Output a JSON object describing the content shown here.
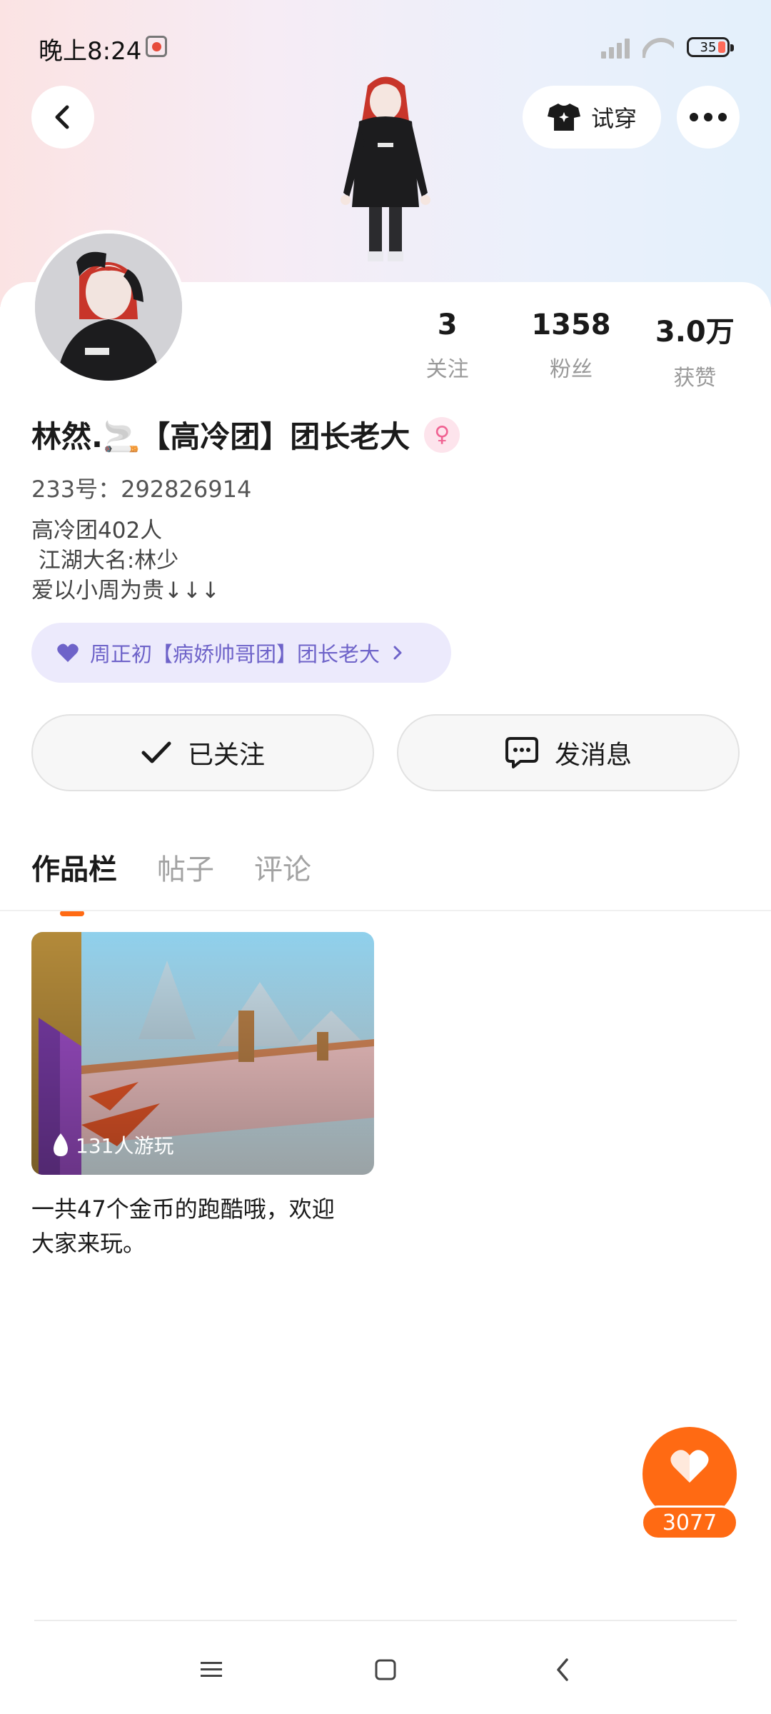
{
  "status_bar": {
    "time": "晚上8:24",
    "battery_level": "35",
    "icons": [
      "notification-icon",
      "signal-icon",
      "wifi-icon",
      "battery-icon"
    ]
  },
  "header": {
    "back_icon": "chevron-left-icon",
    "try_on_label": "试穿",
    "try_on_icon": "tshirt-icon",
    "more_icon": "more-dots-icon"
  },
  "profile": {
    "stats": [
      {
        "value": "3",
        "label": "关注"
      },
      {
        "value": "1358",
        "label": "粉丝"
      },
      {
        "value": "3.0万",
        "label": "获赞"
      }
    ],
    "name": "林然.🚬【高冷团】团长老大",
    "gender_icon": "female-icon",
    "gender_symbol": "♀",
    "uid": "233号：292826914",
    "bio_lines": [
      "高冷团402人",
      " 江湖大名:林少",
      "爱以小周为贵↓↓↓"
    ],
    "group": {
      "icon": "heart-icon",
      "label": "周正初【病娇帅哥团】团长老大",
      "arrow_icon": "chevron-right-icon"
    }
  },
  "actions": {
    "follow_label": "已关注",
    "message_label": "发消息"
  },
  "tabs": [
    {
      "label": "作品栏",
      "active": true
    },
    {
      "label": "帖子",
      "active": false
    },
    {
      "label": "评论",
      "active": false
    }
  ],
  "works": [
    {
      "plays": "131人游玩",
      "title_line1": "一共47个金币的跑酷哦，欢迎",
      "title_line2": "大家来玩。"
    }
  ],
  "like_button": {
    "icon": "heart-icon",
    "count": "3077"
  },
  "nav_bar": {
    "icons": [
      "menu-icon",
      "home-square-icon",
      "back-triangle-icon"
    ]
  },
  "colors": {
    "accent": "#ff6a13",
    "group_pill_bg": "#eceafc",
    "group_pill_text": "#6e63c9"
  }
}
